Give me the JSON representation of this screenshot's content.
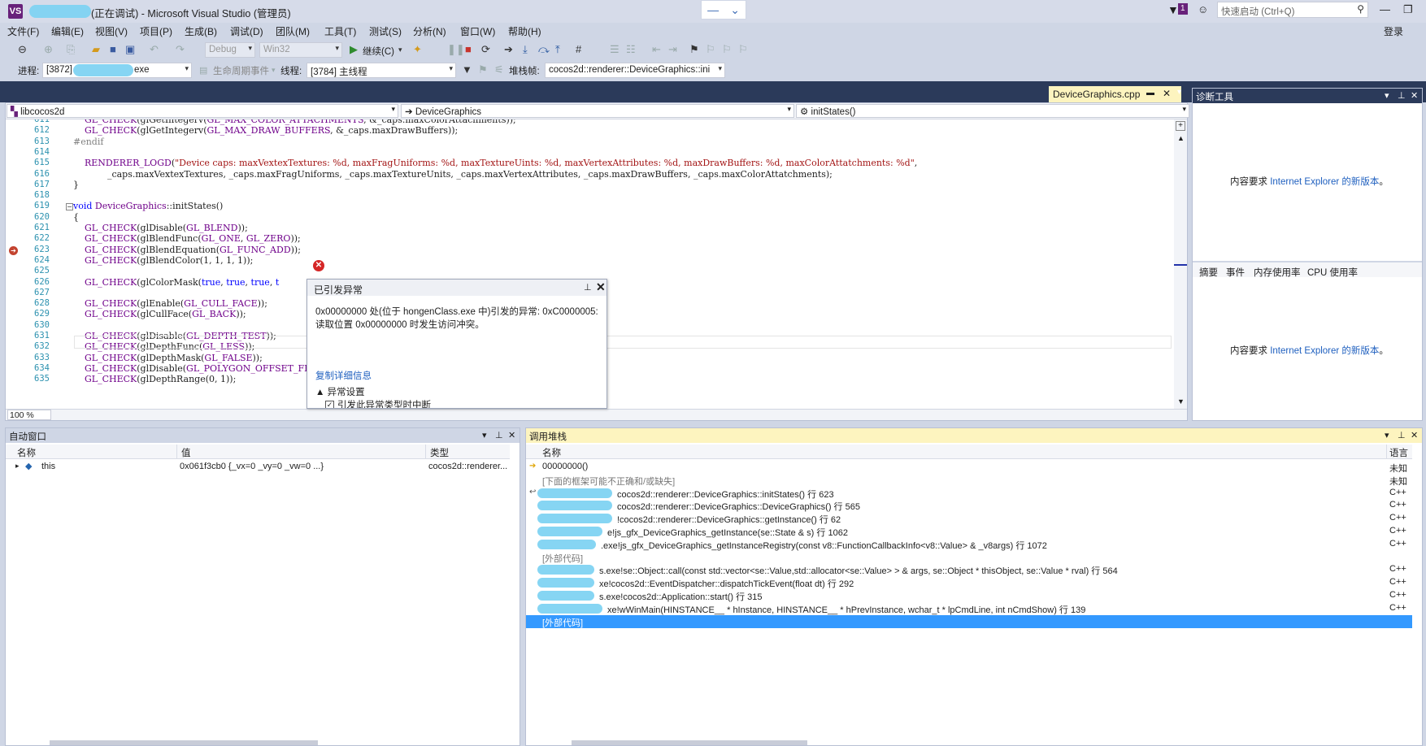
{
  "title_bar": {
    "title": "(正在调试) - Microsoft Visual Studio (管理员)",
    "notification_count": "1",
    "quick_launch_placeholder": "快速启动 (Ctrl+Q)",
    "login": "登录"
  },
  "menu": [
    "文件(F)",
    "编辑(E)",
    "视图(V)",
    "项目(P)",
    "生成(B)",
    "调试(D)",
    "团队(M)",
    "工具(T)",
    "测试(S)",
    "分析(N)",
    "窗口(W)",
    "帮助(H)"
  ],
  "toolbar1": {
    "config": "Debug",
    "platform": "Win32",
    "continue_label": "继续(C)"
  },
  "toolbar2": {
    "process_label": "进程:",
    "process_value": "[3872]",
    "process_suffix": "exe",
    "lifecycle_label": "生命周期事件",
    "thread_label": "线程:",
    "thread_value": "[3784] 主线程",
    "stackframe_label": "堆栈帧:",
    "stackframe_value": "cocos2d::renderer::DeviceGraphics::ini"
  },
  "document_tab": {
    "name": "DeviceGraphics.cpp"
  },
  "editor": {
    "nav_project": "libcocos2d",
    "nav_class": "DeviceGraphics",
    "nav_member": "initStates()",
    "zoom": "100 %",
    "lines": [
      {
        "num": "611",
        "html": "    <span class='macro'>GL_CHECK</span>(glGetIntegerv(<span class='macro'>GL_MAX_COLOR_ATTACHMENTS</span>, &amp;_caps.maxColorAttachments));"
      },
      {
        "num": "612",
        "html": "    <span class='macro'>GL_CHECK</span>(glGetIntegerv(<span class='macro'>GL_MAX_DRAW_BUFFERS</span>, &amp;_caps.maxDrawBuffers));"
      },
      {
        "num": "613",
        "html": "<span class='pp'>#endif</span>"
      },
      {
        "num": "614",
        "html": ""
      },
      {
        "num": "615",
        "html": "    <span class='macro'>RENDERER_LOGD</span>(<span class='str'>\"Device caps: maxVextexTextures: %d, maxFragUniforms: %d, maxTextureUints: %d, maxVertexAttributes: %d, maxDrawBuffers: %d, maxColorAttatchments: %d\"</span>,"
      },
      {
        "num": "616",
        "html": "            _caps.maxVextexTextures, _caps.maxFragUniforms, _caps.maxTextureUnits, _caps.maxVertexAttributes, _caps.maxDrawBuffers, _caps.maxColorAttatchments);"
      },
      {
        "num": "617",
        "html": "}"
      },
      {
        "num": "618",
        "html": ""
      },
      {
        "num": "619",
        "html": "<span class='kw'>void</span> <span class='macro'>DeviceGraphics</span>::initStates()"
      },
      {
        "num": "620",
        "html": "{"
      },
      {
        "num": "621",
        "html": "    <span class='macro'>GL_CHECK</span>(glDisable(<span class='macro'>GL_BLEND</span>));"
      },
      {
        "num": "622",
        "html": "    <span class='macro'>GL_CHECK</span>(glBlendFunc(<span class='macro'>GL_ONE</span>, <span class='macro'>GL_ZERO</span>));"
      },
      {
        "num": "623",
        "html": "    <span class='macro'>GL_CHECK</span>(glBlendEquation(<span class='macro'>GL_FUNC_ADD</span>));"
      },
      {
        "num": "624",
        "html": "    <span class='macro'>GL_CHECK</span>(glBlendColor(1, 1, 1, 1));"
      },
      {
        "num": "625",
        "html": ""
      },
      {
        "num": "626",
        "html": "    <span class='macro'>GL_CHECK</span>(glColorMask(<span class='kw'>true</span>, <span class='kw'>true</span>, <span class='kw'>true</span>, <span class='kw'>t</span>"
      },
      {
        "num": "627",
        "html": ""
      },
      {
        "num": "628",
        "html": "    <span class='macro'>GL_CHECK</span>(glEnable(<span class='macro'>GL_CULL_FACE</span>));"
      },
      {
        "num": "629",
        "html": "    <span class='macro'>GL_CHECK</span>(glCullFace(<span class='macro'>GL_BACK</span>));"
      },
      {
        "num": "630",
        "html": ""
      },
      {
        "num": "631",
        "html": "    <span class='macro'>GL_CHECK</span>(glDisable(<span class='macro'>GL_DEPTH_TEST</span>));"
      },
      {
        "num": "632",
        "html": "    <span class='macro'>GL_CHECK</span>(glDepthFunc(<span class='macro'>GL_LESS</span>));"
      },
      {
        "num": "633",
        "html": "    <span class='macro'>GL_CHECK</span>(glDepthMask(<span class='macro'>GL_FALSE</span>));"
      },
      {
        "num": "634",
        "html": "    <span class='macro'>GL_CHECK</span>(glDisable(<span class='macro'>GL_POLYGON_OFFSET_FIL</span>"
      },
      {
        "num": "635",
        "html": "    <span class='macro'>GL_CHECK</span>(glDepthRange(0, 1));"
      }
    ]
  },
  "exception": {
    "title": "已引发异常",
    "message_line1": "0x00000000 处(位于 hongenClass.exe 中)引发的异常: 0xC0000005:",
    "message_line2": "读取位置 0x00000000 时发生访问冲突。",
    "copy_details": "复制详细信息",
    "settings_header": "▲ 异常设置",
    "break_checkbox": "引发此异常类型时中断"
  },
  "diagnostics": {
    "title": "诊断工具",
    "ie_prefix": "内容要求 ",
    "ie_link": "Internet Explorer 的新版本",
    "ie_suffix": "。",
    "tabs": [
      "摘要",
      "事件",
      "内存使用率",
      "CPU 使用率"
    ]
  },
  "autos": {
    "title": "自动窗口",
    "columns": [
      "名称",
      "值",
      "类型"
    ],
    "rows": [
      {
        "name": "this",
        "value": "0x061f3cb0 {_vx=0 _vy=0 _vw=0 ...}",
        "type": "cocos2d::renderer..."
      }
    ]
  },
  "callstack": {
    "title": "调用堆栈",
    "columns": [
      "名称",
      "语言"
    ],
    "rows": [
      {
        "name": "00000000()",
        "lang": "未知",
        "style": "normal",
        "icon": "current-frame-arrow"
      },
      {
        "name": "[下面的框架可能不正确和/或缺失]",
        "lang": "未知",
        "style": "gray",
        "icon": ""
      },
      {
        "name": "cocos2d::renderer::DeviceGraphics::initStates() 行 623",
        "lang": "C++",
        "style": "normal",
        "icon": "return-arrow"
      },
      {
        "name": "cocos2d::renderer::DeviceGraphics::DeviceGraphics() 行 565",
        "lang": "C++",
        "style": "normal",
        "icon": ""
      },
      {
        "name": "!cocos2d::renderer::DeviceGraphics::getInstance() 行 62",
        "lang": "C++",
        "style": "normal",
        "icon": ""
      },
      {
        "name": "e!js_gfx_DeviceGraphics_getInstance(se::State & s) 行 1062",
        "lang": "C++",
        "style": "normal",
        "icon": ""
      },
      {
        "name": ".exe!js_gfx_DeviceGraphics_getInstanceRegistry(const v8::FunctionCallbackInfo<v8::Value> & _v8args) 行 1072",
        "lang": "C++",
        "style": "normal",
        "icon": ""
      },
      {
        "name": "[外部代码]",
        "lang": "",
        "style": "gray",
        "icon": ""
      },
      {
        "name": "s.exe!se::Object::call(const std::vector<se::Value,std::allocator<se::Value> > & args, se::Object * thisObject, se::Value * rval) 行 564",
        "lang": "C++",
        "style": "normal",
        "icon": ""
      },
      {
        "name": "xe!cocos2d::EventDispatcher::dispatchTickEvent(float dt) 行 292",
        "lang": "C++",
        "style": "normal",
        "icon": ""
      },
      {
        "name": "s.exe!cocos2d::Application::start() 行 315",
        "lang": "C++",
        "style": "normal",
        "icon": ""
      },
      {
        "name": "xe!wWinMain(HINSTANCE__ * hInstance, HINSTANCE__ * hPrevInstance, wchar_t * lpCmdLine, int nCmdShow) 行 139",
        "lang": "C++",
        "style": "normal",
        "icon": ""
      },
      {
        "name": "[外部代码]",
        "lang": "",
        "style": "selected",
        "icon": ""
      }
    ]
  }
}
